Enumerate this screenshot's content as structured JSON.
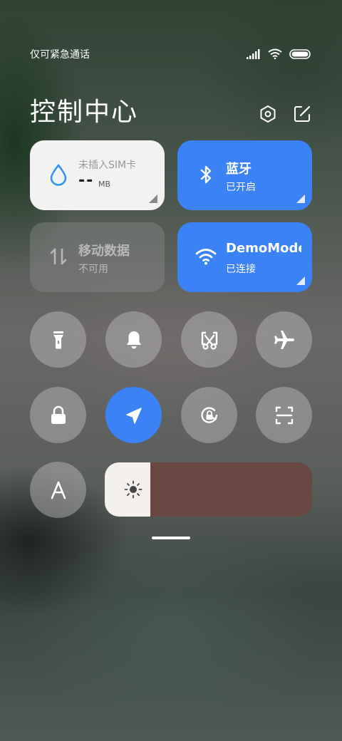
{
  "status_bar": {
    "carrier_text": "仅可紧急通话"
  },
  "header": {
    "title": "控制中心"
  },
  "tiles": {
    "data": {
      "label": "未插入SIM卡",
      "value": "--",
      "unit": "MB"
    },
    "bluetooth": {
      "name": "蓝牙",
      "status": "已开启",
      "active": true
    },
    "mobile_data": {
      "name": "移动数据",
      "status": "不可用",
      "active": false
    },
    "wifi": {
      "name": "DemoMode",
      "status": "已连接",
      "active": true
    }
  },
  "toggles": [
    {
      "icon": "flashlight-icon",
      "active": false
    },
    {
      "icon": "bell-icon",
      "active": false
    },
    {
      "icon": "screenshot-icon",
      "active": false
    },
    {
      "icon": "airplane-icon",
      "active": false
    },
    {
      "icon": "lock-icon",
      "active": false
    },
    {
      "icon": "location-icon",
      "active": true
    },
    {
      "icon": "rotation-lock-icon",
      "active": false
    },
    {
      "icon": "scan-icon",
      "active": false
    },
    {
      "icon": "font-size-icon",
      "active": false
    }
  ],
  "brightness": {
    "level": 0.22
  },
  "colors": {
    "accent": "#3b82f6",
    "tile_light": "#f2f2f2",
    "brightness_track": "#6a4740"
  }
}
